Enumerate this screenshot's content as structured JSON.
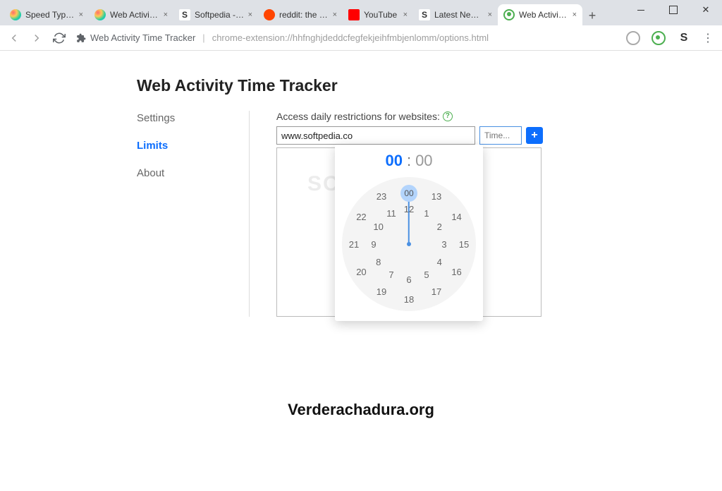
{
  "window": {
    "tabs": [
      {
        "title": "Speed Typing",
        "fav": "fav-swirl"
      },
      {
        "title": "Web Activity T",
        "fav": "fav-swirl"
      },
      {
        "title": "Softpedia - Fr",
        "fav": "fav-s"
      },
      {
        "title": "reddit: the fro",
        "fav": "fav-r"
      },
      {
        "title": "YouTube",
        "fav": "fav-y"
      },
      {
        "title": "Latest News &",
        "fav": "fav-s"
      },
      {
        "title": "Web Activity T",
        "fav": "fav-g",
        "active": true
      }
    ]
  },
  "addr": {
    "ext_label": "Web Activity Time Tracker",
    "url": "chrome-extension://hhfnghjdeddcfegfekjeihfmbjenlomm/options.html"
  },
  "page": {
    "title": "Web Activity Time Tracker",
    "sidebar": [
      {
        "label": "Settings",
        "active": false
      },
      {
        "label": "Limits",
        "active": true
      },
      {
        "label": "About",
        "active": false
      }
    ],
    "access_label": "Access daily restrictions for websites:",
    "domain_value": "www.softpedia.co",
    "time_placeholder": "Time...",
    "add_symbol": "+"
  },
  "timepicker": {
    "hour": "00",
    "minute": "00",
    "selected": "00",
    "outer": [
      "00",
      "13",
      "14",
      "15",
      "16",
      "17",
      "18",
      "19",
      "20",
      "21",
      "22",
      "23"
    ],
    "inner": [
      "12",
      "1",
      "2",
      "3",
      "4",
      "5",
      "6",
      "7",
      "8",
      "9",
      "10",
      "11"
    ]
  },
  "watermark_top": "SOFTPEDIA",
  "watermark_bottom": "Verderachadura.org"
}
